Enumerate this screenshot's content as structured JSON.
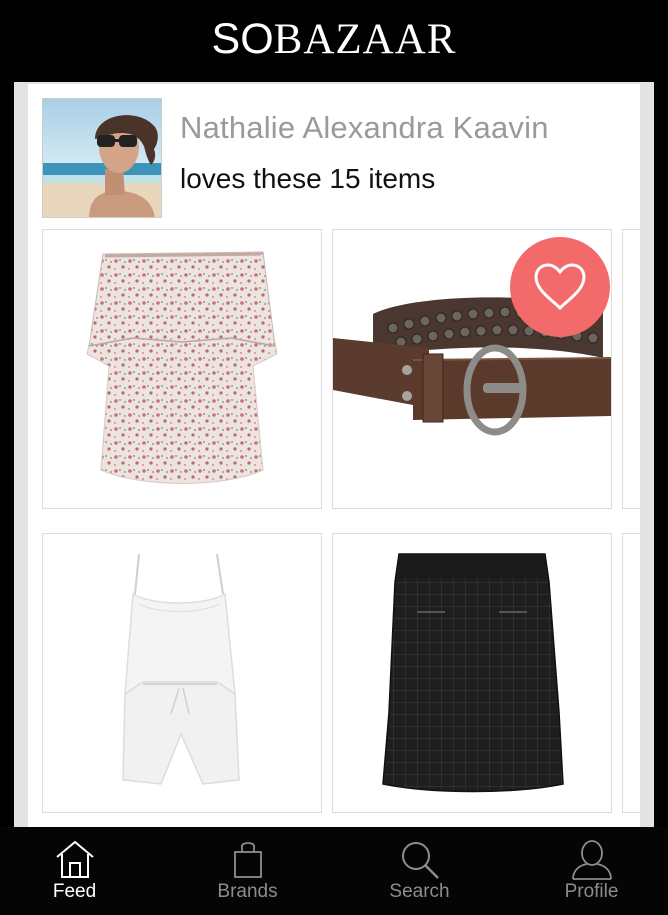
{
  "header": {
    "logo_prefix": "SO",
    "logo_main": "BAZAAR"
  },
  "user": {
    "name": "Nathalie Alexandra Kaavin",
    "subtitle": "loves these 15 items"
  },
  "items": [
    {
      "name": "Floral off-shoulder top",
      "liked": false
    },
    {
      "name": "Studded brown leather belt",
      "liked": true
    },
    {
      "name": "White strappy playsuit",
      "liked": false
    },
    {
      "name": "Black quilted leather skirt",
      "liked": false
    }
  ],
  "tabs": [
    {
      "label": "Feed",
      "icon": "home-icon",
      "active": true
    },
    {
      "label": "Brands",
      "icon": "shopping-bag-icon",
      "active": false
    },
    {
      "label": "Search",
      "icon": "search-icon",
      "active": false
    },
    {
      "label": "Profile",
      "icon": "person-icon",
      "active": false
    }
  ],
  "colors": {
    "like": "#f26a6a",
    "background": "#000000",
    "tab_active": "#ffffff",
    "tab_inactive": "#8d8d8d"
  }
}
